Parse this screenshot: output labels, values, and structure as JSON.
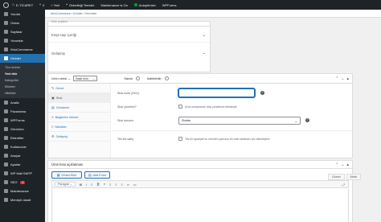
{
  "adminbar": {
    "site_name": "E-TİCARET",
    "comments_count": "0",
    "new_label": "+ Yeni",
    "cache_label": "Önbelleği Temizle",
    "maintenance_label": "Maintenance is On",
    "autoptimize_label": "Autoptimize",
    "wpforms_label": "WPForms"
  },
  "sidebar": {
    "items_top": [
      {
        "label": "Yazılar"
      },
      {
        "label": "Ortam"
      },
      {
        "label": "Sayfalar"
      },
      {
        "label": "Yorumlar"
      },
      {
        "label": "WooCommerce"
      }
    ],
    "active_label": "Ürünler",
    "submenu": [
      {
        "label": "Tüm ürünler"
      },
      {
        "label": "Yeni ekle"
      },
      {
        "label": "Kategoriler"
      },
      {
        "label": "Etiketler"
      },
      {
        "label": "Nitelikler"
      }
    ],
    "items_bottom": [
      {
        "label": "Analiz"
      },
      {
        "label": "Pazarlama"
      },
      {
        "label": "WPForms"
      },
      {
        "label": "Görünüm"
      },
      {
        "label": "Eklentiler"
      },
      {
        "label": "Kullanıcılar"
      },
      {
        "label": "Araçlar"
      },
      {
        "label": "Ayarlar"
      },
      {
        "label": "WP Mail SMTP"
      },
      {
        "label": "SEO"
      },
      {
        "label": "Maintenance"
      },
      {
        "label": "Menüyü daralt"
      }
    ],
    "seo_badge": "2"
  },
  "breadcrumb": {
    "root": "WooCommerce",
    "sep": "/",
    "section": "Ürünler",
    "current": "Yeni ekle"
  },
  "panels": {
    "cover_label": "Kitle çeşitleri",
    "corner_content_label": "Köşe taşı içeriği",
    "advanced_label": "Gelişmiş"
  },
  "product_data": {
    "title": "Ürün verisi —",
    "type_value": "Basit ürün",
    "virtual_label": "Sanal:",
    "downloadable_label": "İndirilebilir:",
    "tabs": [
      {
        "label": "Genel",
        "icon": "wrench-icon"
      },
      {
        "label": "Stok",
        "icon": "box-icon"
      },
      {
        "label": "Gönderim",
        "icon": "truck-icon"
      },
      {
        "label": "Bağlantılı ürünler",
        "icon": "link-icon"
      },
      {
        "label": "Nitelikler",
        "icon": "list-icon"
      },
      {
        "label": "Gelişmiş",
        "icon": "gear-icon"
      }
    ],
    "sku_label": "Stok kodu (SKU)",
    "sku_value": "",
    "manage_stock_label": "Stok yönetimi?",
    "manage_stock_desc": "Ürün seviyesinde stok yönetimini etkinleştir",
    "stock_status_label": "Stok durumu",
    "stock_status_value": "Stokta",
    "sold_individually_label": "Tek tek satış",
    "sold_individually_desc": "Tek bir siparişte bu üründen yalnızca bir adet satılması için etkinleştirin"
  },
  "short_description": {
    "title": "Ürün kısa açıklaması",
    "add_media_label": "Ortam Ekle",
    "add_form_label": "Add Form",
    "visual_tab": "Görsel",
    "text_tab": "Metin",
    "format_value": "Paragraf"
  }
}
